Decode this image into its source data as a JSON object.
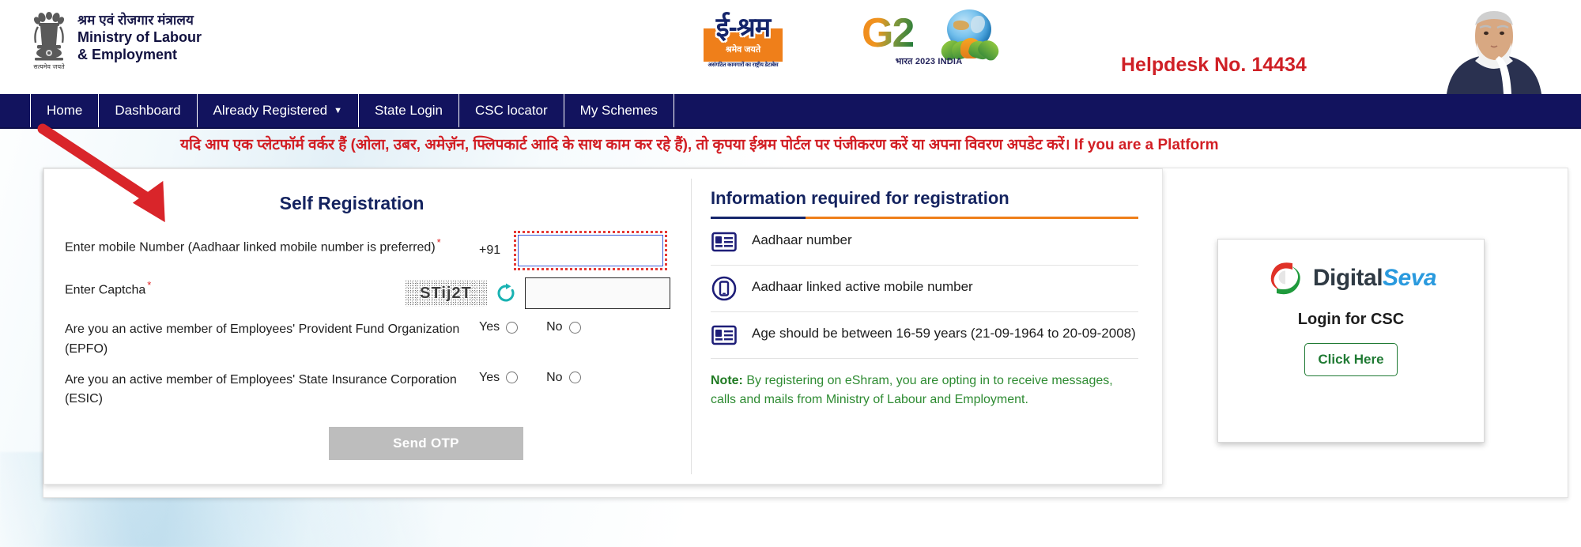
{
  "header": {
    "ministry_hi": "श्रम एवं रोजगार मंत्रालय",
    "ministry_en_line1": "Ministry of Labour",
    "ministry_en_line2": "& Employment",
    "emblem_motto": "सत्यमेव जयते",
    "eshram_word": "ई-श्रम",
    "eshram_tagline": "श्रमेव जयते",
    "eshram_subtagline": "असंगठित कामगारों का राष्ट्रीय डेटाबेस",
    "g20_text": "G2",
    "g20_caption": "भारत 2023 INDIA",
    "helpdesk": "Helpdesk No. 14434"
  },
  "nav": {
    "items": [
      {
        "label": "Home",
        "has_caret": false
      },
      {
        "label": "Dashboard",
        "has_caret": false
      },
      {
        "label": "Already Registered",
        "has_caret": true
      },
      {
        "label": "State Login",
        "has_caret": false
      },
      {
        "label": "CSC locator",
        "has_caret": false
      },
      {
        "label": "My Schemes",
        "has_caret": false
      }
    ]
  },
  "marquee": {
    "text": "यदि आप एक प्लेटफॉर्म वर्कर हैं (ओला, उबर, अमेज़ॅन, फ्लिपकार्ट आदि के साथ काम कर रहे हैं), तो कृपया ईश्रम पोर्टल पर पंजीकरण करें या अपना विवरण अपडेट करें। If you are a Platform"
  },
  "self_registration": {
    "title": "Self Registration",
    "mobile_label": "Enter mobile Number (Aadhaar linked mobile number is preferred)",
    "mobile_prefix": "+91",
    "mobile_value": "",
    "mobile_placeholder": "",
    "captcha_label": "Enter Captcha",
    "captcha_text": "STij2T",
    "captcha_value": "",
    "refresh_icon": "refresh-icon",
    "epfo_label": "Are you an active member of Employees' Provident Fund Organization (EPFO)",
    "esic_label": "Are you an active member of Employees' State Insurance Corporation (ESIC)",
    "yes_label": "Yes",
    "no_label": "No",
    "send_otp_label": "Send OTP"
  },
  "info_panel": {
    "title": "Information required for registration",
    "rows": [
      {
        "icon": "id-card-icon",
        "text": "Aadhaar number"
      },
      {
        "icon": "mobile-phone-icon",
        "text": "Aadhaar linked active mobile number"
      },
      {
        "icon": "id-card-icon",
        "text": "Age should be between 16-59 years (21-09-1964 to 20-09-2008)"
      }
    ],
    "note_label": "Note:",
    "note_text": " By registering on eShram, you are opting in to receive messages, calls and mails from Ministry of Labour and Employment."
  },
  "csc_card": {
    "logo_word_dark": "Digital",
    "logo_word_light": "Seva",
    "subtitle": "Login for CSC",
    "button_label": "Click Here"
  },
  "colors": {
    "nav_blue": "#12135e",
    "brand_navy": "#14235f",
    "accent_orange": "#ef7f1a",
    "helpdesk_red": "#cf2026",
    "marquee_red": "#d21e24",
    "note_green": "#2e8b32",
    "csc_green": "#1f7a33",
    "annotation_red": "#d9252a"
  }
}
